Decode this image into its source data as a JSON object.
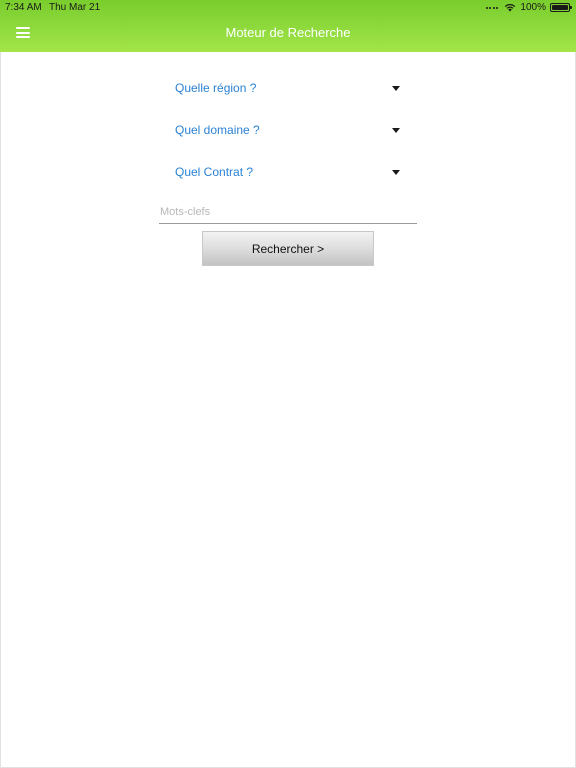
{
  "status_bar": {
    "time": "7:34 AM",
    "date": "Thu Mar 21",
    "battery": "100%",
    "icons": [
      "signal-icon",
      "wifi-icon",
      "battery-icon"
    ]
  },
  "header": {
    "title": "Moteur de Recherche",
    "menu_icon": "hamburger-menu-icon",
    "colors": {
      "gradient_top": "#79cd2c",
      "gradient_bottom": "#a4e549",
      "text": "#ffffff"
    }
  },
  "form": {
    "selects": [
      {
        "label": "Quelle région ?"
      },
      {
        "label": "Quel domaine ?"
      },
      {
        "label": "Quel Contrat ?"
      }
    ],
    "label_color": "#2a82d4",
    "keywords": {
      "placeholder": "Mots-clefs",
      "value": ""
    },
    "search_button": "Rechercher >"
  }
}
